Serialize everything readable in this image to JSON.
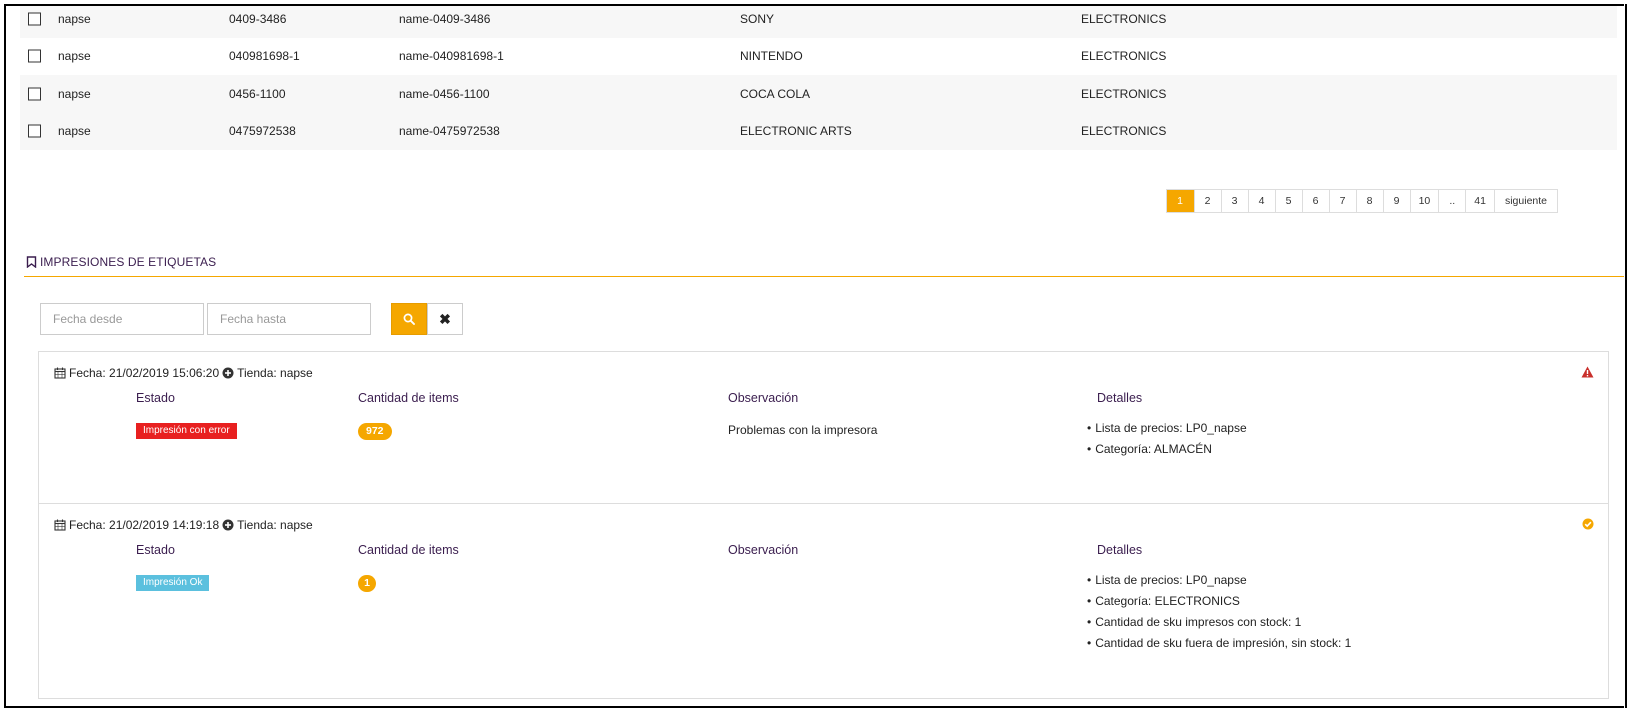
{
  "products": {
    "rows": [
      {
        "store": "napse",
        "code": "0409-3486",
        "name": "name-0409-3486",
        "brand": "SONY",
        "category": "ELECTRONICS"
      },
      {
        "store": "napse",
        "code": "040981698-1",
        "name": "name-040981698-1",
        "brand": "NINTENDO",
        "category": "ELECTRONICS"
      },
      {
        "store": "napse",
        "code": "0456-1100",
        "name": "name-0456-1100",
        "brand": "COCA COLA",
        "category": "ELECTRONICS"
      },
      {
        "store": "napse",
        "code": "0475972538",
        "name": "name-0475972538",
        "brand": "ELECTRONIC ARTS",
        "category": "ELECTRONICS"
      }
    ]
  },
  "pagination": {
    "pages": [
      "1",
      "2",
      "3",
      "4",
      "5",
      "6",
      "7",
      "8",
      "9",
      "10",
      "..",
      "41"
    ],
    "active": "1",
    "next_label": "siguiente"
  },
  "section": {
    "title": "IMPRESIONES DE ETIQUETAS",
    "icon": "bookmark-icon"
  },
  "filters": {
    "date_from_placeholder": "Fecha desde",
    "date_to_placeholder": "Fecha hasta",
    "search_icon": "search-icon",
    "clear_icon": "close-icon"
  },
  "prints": [
    {
      "header": "Fecha: 21/02/2019 15:06:20",
      "store": "Tienda: napse",
      "col_estado": "Estado",
      "col_cantidad": "Cantidad de items",
      "col_observacion": "Observación",
      "col_detalles": "Detalles",
      "estado": "Impresión con error",
      "cantidad": "972",
      "observacion": "Problemas con la impresora",
      "detalles": [
        "Lista de precios: LP0_napse",
        "Categoría: ALMACÉN"
      ],
      "status_icon": "warning-icon",
      "status_color": "#c9302c"
    },
    {
      "header": "Fecha: 21/02/2019 14:19:18",
      "store": "Tienda: napse",
      "col_estado": "Estado",
      "col_cantidad": "Cantidad de items",
      "col_observacion": "Observación",
      "col_detalles": "Detalles",
      "estado": "Impresión Ok",
      "cantidad": "1",
      "observacion": "",
      "detalles": [
        "Lista de precios: LP0_napse",
        "Categoría: ELECTRONICS",
        "Cantidad de sku impresos con stock: 1",
        "Cantidad de sku fuera de impresión, sin stock: 1"
      ],
      "status_icon": "check-circle-icon",
      "status_color": "#f5a700"
    }
  ],
  "colors": {
    "accent": "#f5a700",
    "error": "#e82020",
    "ok": "#5bc0de",
    "heading": "#3a1d4e"
  }
}
